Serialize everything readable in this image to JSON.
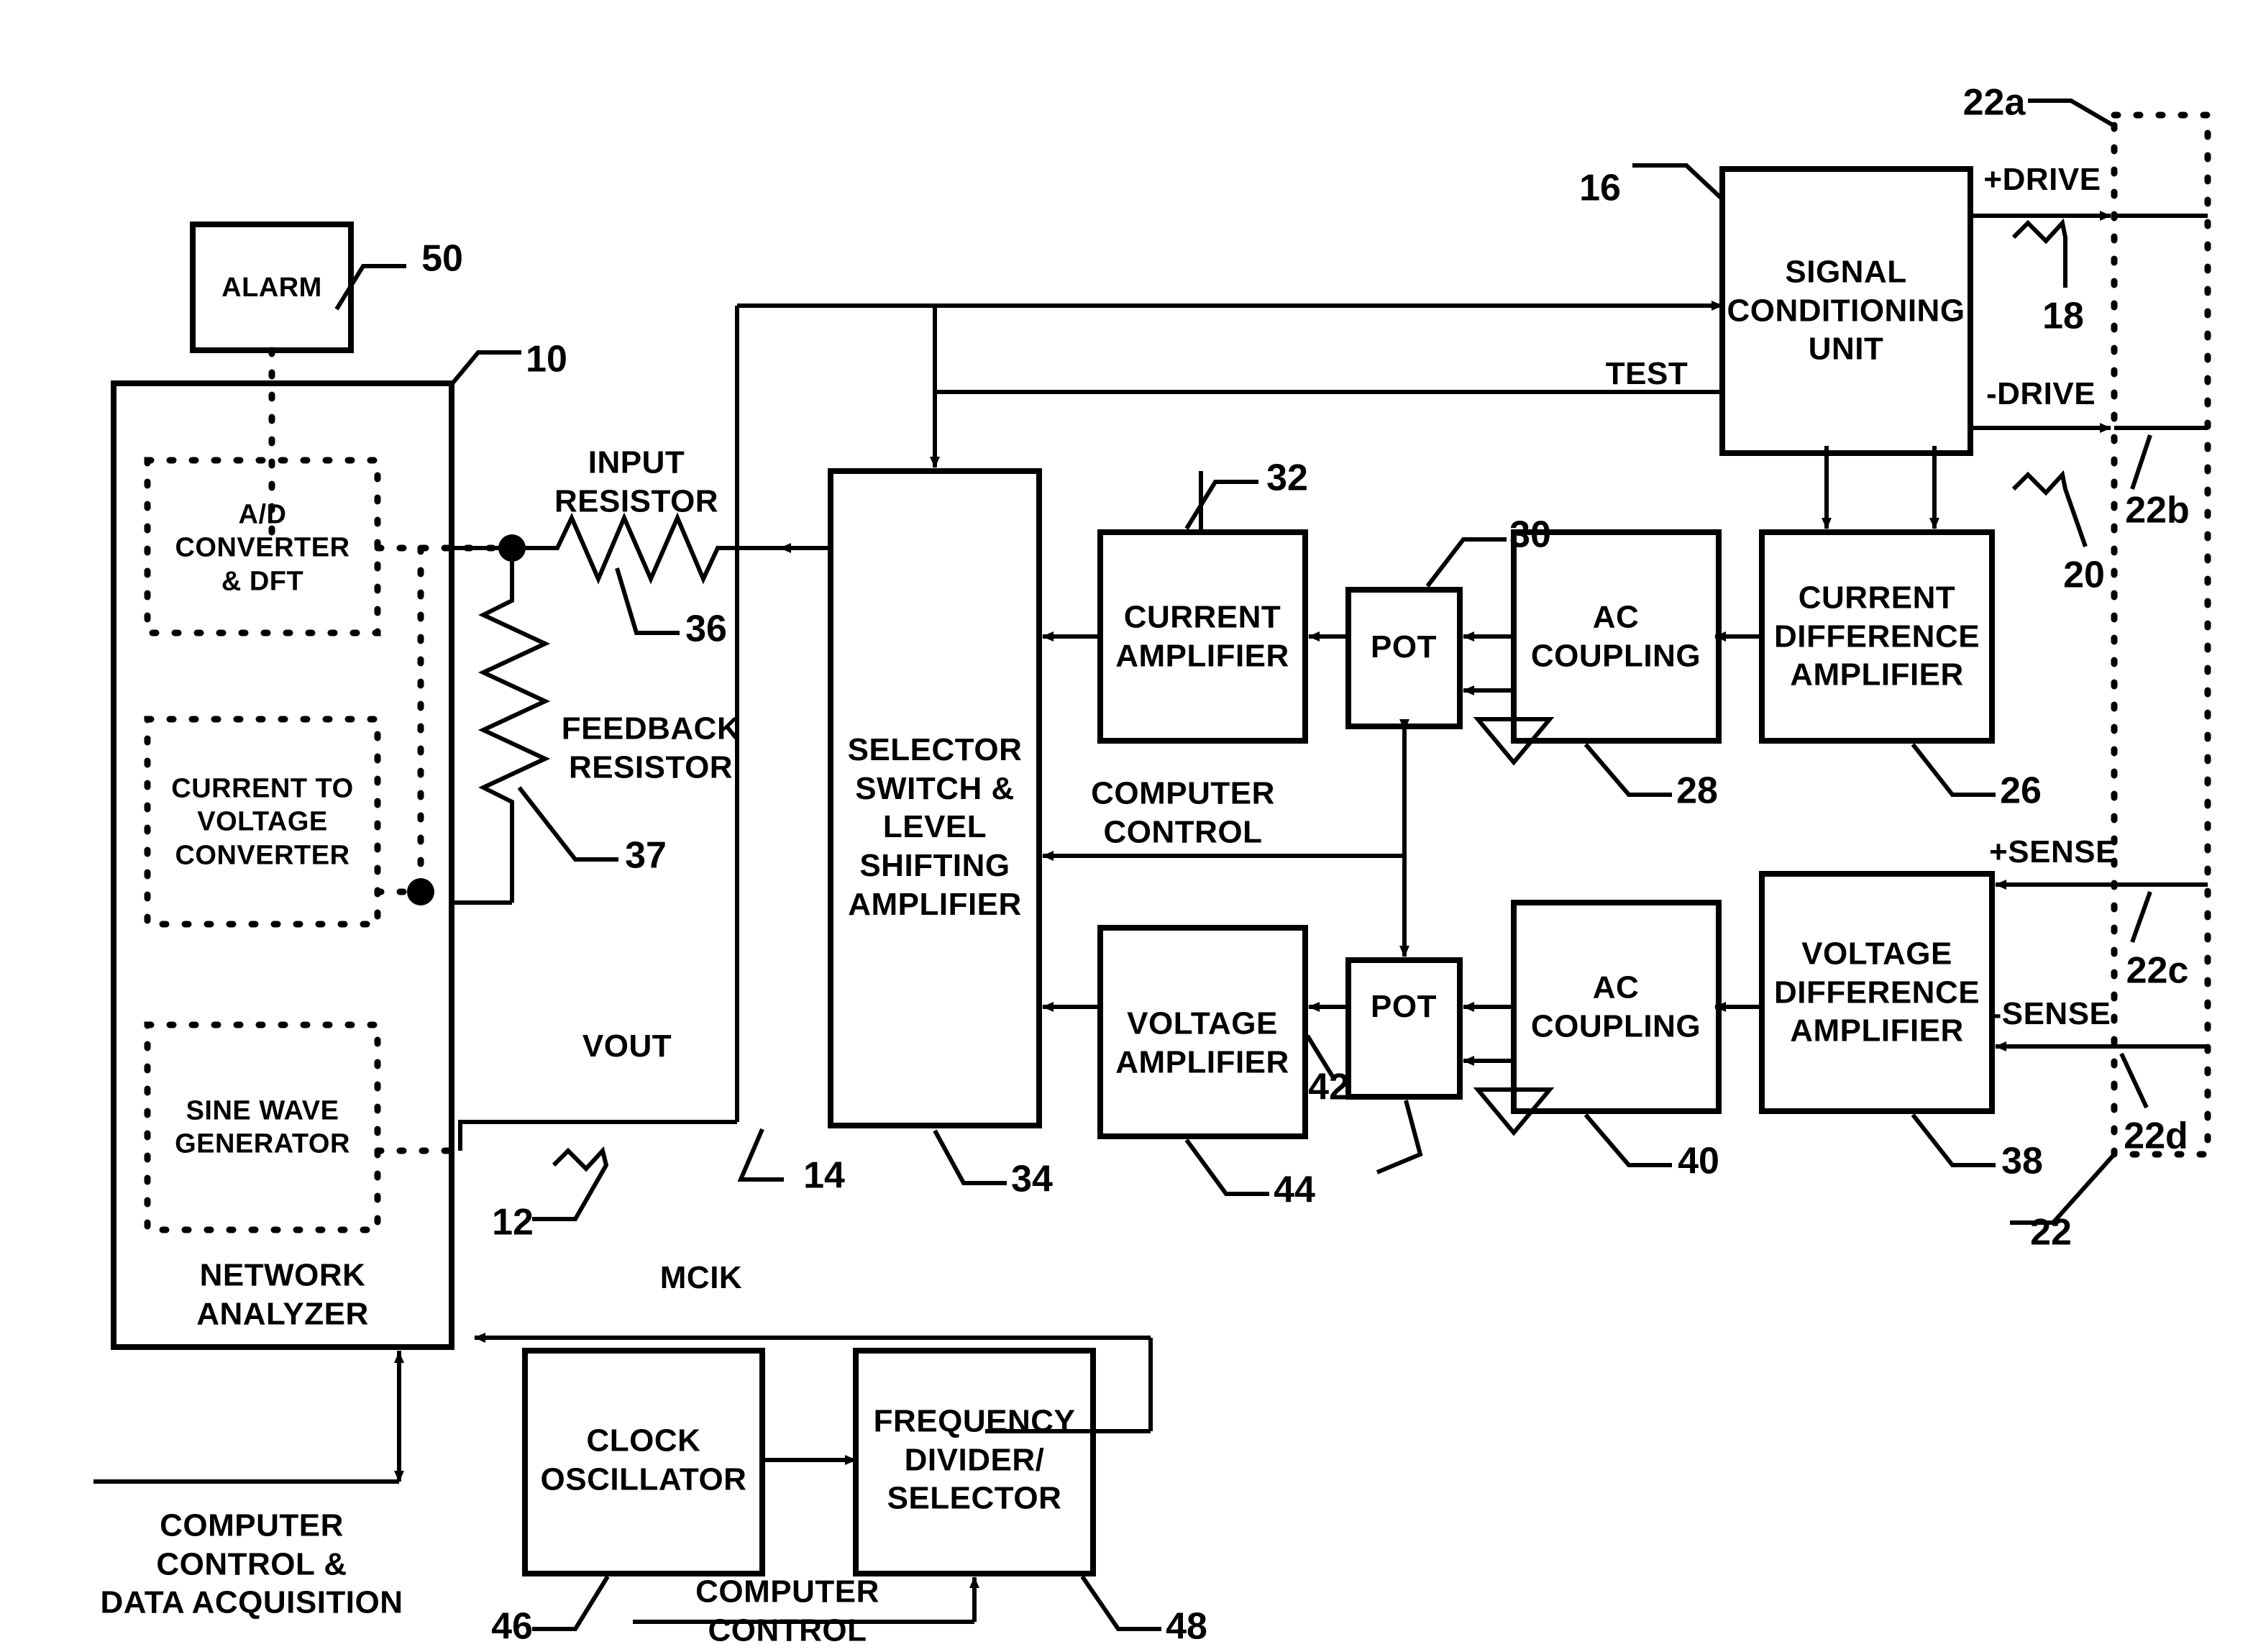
{
  "diagram": {
    "title_domain": "electronic block diagram",
    "blocks": {
      "alarm": "ALARM",
      "ad_converter": "A/D\nCONVERTER\n& DFT",
      "current_to_voltage": "CURRENT TO\nVOLTAGE\nCONVERTER",
      "sine_wave_generator": "SINE WAVE\nGENERATOR",
      "network_analyzer": "NETWORK\nANALYZER",
      "selector_switch": "SELECTOR\nSWITCH &\nLEVEL\nSHIFTING\nAMPLIFIER",
      "current_amplifier": "CURRENT\nAMPLIFIER",
      "voltage_amplifier": "VOLTAGE\nAMPLIFIER",
      "pot_top": "POT",
      "pot_bottom": "POT",
      "ac_coupling_top": "AC\nCOUPLING",
      "ac_coupling_bottom": "AC\nCOUPLING",
      "current_difference_amplifier": "CURRENT\nDIFFERENCE\nAMPLIFIER",
      "voltage_difference_amplifier": "VOLTAGE\nDIFFERENCE\nAMPLIFIER",
      "signal_conditioning_unit": "SIGNAL\nCONDITIONING\nUNIT",
      "clock_oscillator": "CLOCK\nOSCILLATOR",
      "frequency_divider": "FREQUENCY\nDIVIDER/\nSELECTOR"
    },
    "signal_labels": {
      "input_resistor": "INPUT\nRESISTOR",
      "feedback_resistor": "FEEDBACK\nRESISTOR",
      "vout": "VOUT",
      "test": "TEST",
      "mclk": "MCIK",
      "computer_control_mid": "COMPUTER\nCONTROL",
      "computer_control_bottom": "COMPUTER\nCONTROL",
      "computer_control_data_acq": "COMPUTER\nCONTROL &\nDATA ACQUISITION",
      "plus_drive": "+DRIVE",
      "minus_drive": "-DRIVE",
      "plus_sense": "+SENSE",
      "minus_sense": "-SENSE"
    },
    "reference_numerals": {
      "n10": "10",
      "n12": "12",
      "n14": "14",
      "n16": "16",
      "n18": "18",
      "n20": "20",
      "n22": "22",
      "n22a": "22a",
      "n22b": "22b",
      "n22c": "22c",
      "n22d": "22d",
      "n26": "26",
      "n28": "28",
      "n30": "30",
      "n32": "32",
      "n34": "34",
      "n36": "36",
      "n37": "37",
      "n38": "38",
      "n40": "40",
      "n42": "42",
      "n44": "44",
      "n46": "46",
      "n48": "48",
      "n50": "50"
    },
    "colors": {
      "line": "#000000",
      "background": "#ffffff"
    }
  }
}
